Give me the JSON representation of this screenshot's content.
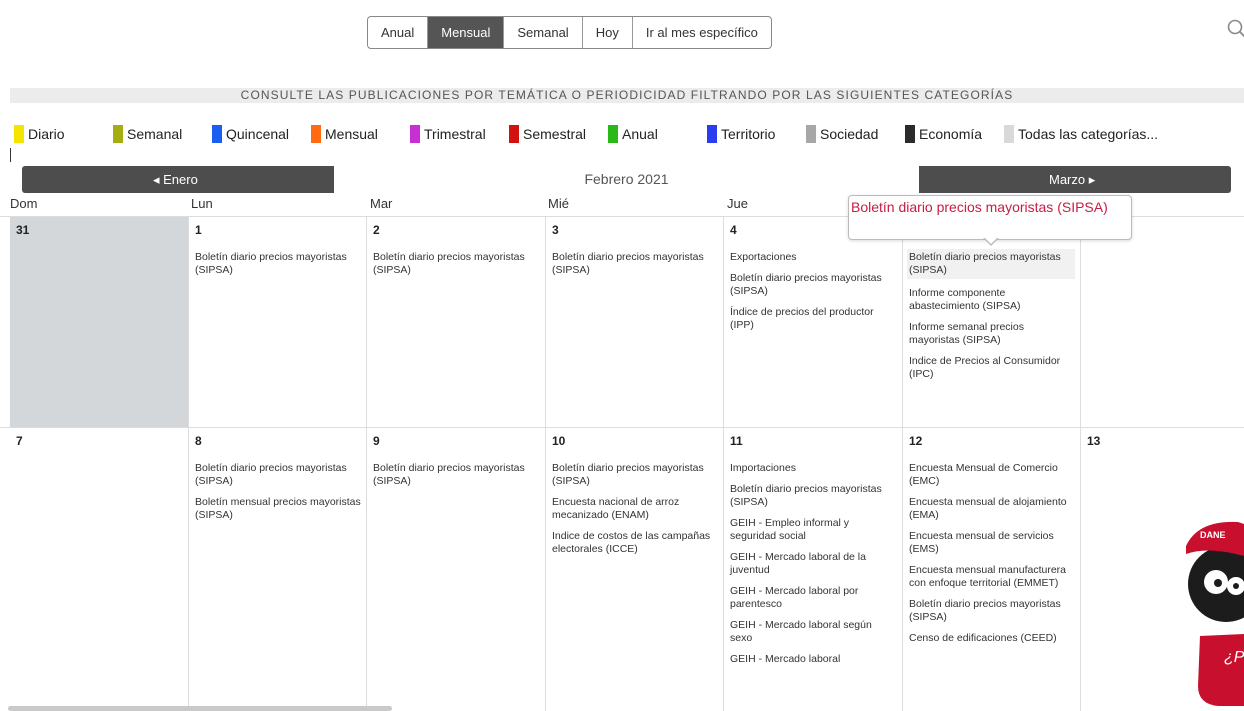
{
  "toolbar": {
    "buttons": [
      "Anual",
      "Mensual",
      "Semanal",
      "Hoy",
      "Ir al mes específico"
    ],
    "active": "Mensual"
  },
  "consult_text": "CONSULTE LAS PUBLICACIONES POR TEMÁTICA O PERIODICIDAD FILTRANDO POR LAS SIGUIENTES CATEGORÍAS",
  "categories": [
    {
      "label": "Diario",
      "color": "#f5e400"
    },
    {
      "label": "Semanal",
      "color": "#a4ad12"
    },
    {
      "label": "Quincenal",
      "color": "#1a5ff0"
    },
    {
      "label": "Mensual",
      "color": "#ff6a13"
    },
    {
      "label": "Trimestral",
      "color": "#c62fd3"
    },
    {
      "label": "Semestral",
      "color": "#d21111"
    },
    {
      "label": "Anual",
      "color": "#2ab818"
    },
    {
      "label": "Territorio",
      "color": "#2a3cf0"
    },
    {
      "label": "Sociedad",
      "color": "#a7a7a7"
    },
    {
      "label": "Economía",
      "color": "#2b2b2b"
    },
    {
      "label": "Todas las categorías...",
      "color": "#d9d9d9"
    }
  ],
  "nav": {
    "prev": "Enero",
    "current": "Febrero 2021",
    "next": "Marzo"
  },
  "weekdays": [
    "Dom",
    "Lun",
    "Mar",
    "Mié",
    "Jue"
  ],
  "week1": [
    {
      "day": "31",
      "events": []
    },
    {
      "day": "1",
      "events": [
        "Boletín diario precios mayoristas (SIPSA)"
      ]
    },
    {
      "day": "2",
      "events": [
        "Boletín diario precios mayoristas (SIPSA)"
      ]
    },
    {
      "day": "3",
      "events": [
        "Boletín diario precios mayoristas (SIPSA)"
      ]
    },
    {
      "day": "4",
      "events": [
        "Exportaciones",
        "Boletín diario precios mayoristas (SIPSA)",
        "Índice de precios del productor (IPP)"
      ]
    },
    {
      "day": "",
      "events": [
        "Boletín diario precios mayoristas (SIPSA)",
        "Informe componente abastecimiento (SIPSA)",
        "Informe semanal precios mayoristas (SIPSA)",
        "Indice de Precios al Consumidor (IPC)"
      ]
    },
    {
      "day": "",
      "events": []
    }
  ],
  "week2": [
    {
      "day": "7",
      "events": []
    },
    {
      "day": "8",
      "events": [
        "Boletín diario precios mayoristas (SIPSA)",
        "Boletín mensual precios mayoristas (SIPSA)"
      ]
    },
    {
      "day": "9",
      "events": [
        "Boletín diario precios mayoristas (SIPSA)"
      ]
    },
    {
      "day": "10",
      "events": [
        "Boletín diario precios mayoristas (SIPSA)",
        "Encuesta nacional de arroz mecanizado (ENAM)",
        "Indice de costos de las campañas electorales (ICCE)"
      ]
    },
    {
      "day": "11",
      "events": [
        "Importaciones",
        "Boletín diario precios mayoristas (SIPSA)",
        "GEIH - Empleo informal y seguridad social",
        "GEIH - Mercado laboral de la juventud",
        "GEIH - Mercado laboral por parentesco",
        "GEIH - Mercado laboral según sexo",
        "GEIH - Mercado laboral"
      ]
    },
    {
      "day": "12",
      "events": [
        "Encuesta Mensual de Comercio (EMC)",
        "Encuesta mensual de alojamiento (EMA)",
        "Encuesta mensual de servicios (EMS)",
        "Encuesta mensual manufacturera con enfoque territorial (EMMET)",
        "Boletín diario precios mayoristas (SIPSA)",
        "Censo de edificaciones (CEED)"
      ]
    },
    {
      "day": "13",
      "events": []
    }
  ],
  "tooltip": "Boletín diario precios mayoristas (SIPSA)",
  "mascot": {
    "cap_text": "DANE",
    "bubble_text": "¿P ay"
  }
}
